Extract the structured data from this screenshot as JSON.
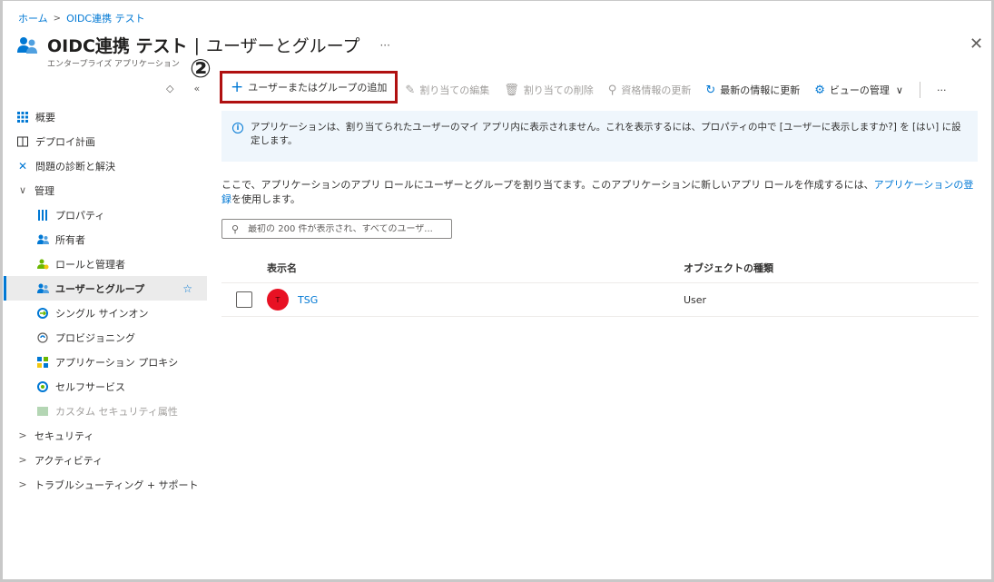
{
  "breadcrumb": {
    "home": "ホーム",
    "current": "OIDC連携 テスト"
  },
  "header": {
    "title": "OIDC連携 テスト",
    "page": "ユーザーとグループ",
    "separator": "|",
    "subtitle": "エンタープライズ アプリケーション",
    "more": "···",
    "close": "✕"
  },
  "annotation": "②",
  "sidebar": {
    "items": [
      {
        "label": "概要",
        "icon": "grid-icon",
        "level": 0
      },
      {
        "label": "デプロイ計画",
        "icon": "book-icon",
        "level": 0
      },
      {
        "label": "問題の診断と解決",
        "icon": "wrench-icon",
        "level": 0
      },
      {
        "label": "管理",
        "icon": "chevron-down-icon",
        "level": 0
      },
      {
        "label": "プロパティ",
        "icon": "properties-icon",
        "level": 1
      },
      {
        "label": "所有者",
        "icon": "owners-icon",
        "level": 1
      },
      {
        "label": "ロールと管理者",
        "icon": "roles-icon",
        "level": 1
      },
      {
        "label": "ユーザーとグループ",
        "icon": "users-icon",
        "level": 1,
        "selected": true
      },
      {
        "label": "シングル サインオン",
        "icon": "sso-icon",
        "level": 1
      },
      {
        "label": "プロビジョニング",
        "icon": "provisioning-icon",
        "level": 1
      },
      {
        "label": "アプリケーション プロキシ",
        "icon": "proxy-icon",
        "level": 1
      },
      {
        "label": "セルフサービス",
        "icon": "selfservice-icon",
        "level": 1
      },
      {
        "label": "カスタム セキュリティ属性",
        "icon": "custom-attr-icon",
        "level": 1,
        "disabled": true
      },
      {
        "label": "セキュリティ",
        "icon": "chevron-right-icon",
        "level": 0
      },
      {
        "label": "アクティビティ",
        "icon": "chevron-right-icon",
        "level": 0
      },
      {
        "label": "トラブルシューティング + サポート",
        "icon": "chevron-right-icon",
        "level": 0
      }
    ]
  },
  "toolbar": {
    "add": "ユーザーまたはグループの追加",
    "edit": "割り当ての編集",
    "remove": "割り当ての削除",
    "credentials": "資格情報の更新",
    "refresh": "最新の情報に更新",
    "manage_view": "ビューの管理",
    "more": "···"
  },
  "info": {
    "text": "アプリケーションは、割り当てられたユーザーのマイ アプリ内に表示されません。これを表示するには、プロパティの中で [ユーザーに表示しますか?] を [はい] に設定します。"
  },
  "description": {
    "text": "ここで、アプリケーションのアプリ ロールにユーザーとグループを割り当てます。このアプリケーションに新しいアプリ ロールを作成するには、",
    "link": "アプリケーションの登録",
    "suffix": "を使用します。"
  },
  "search": {
    "placeholder": "最初の 200 件が表示され、すべてのユーザ..."
  },
  "table": {
    "headers": {
      "name": "表示名",
      "type": "オブジェクトの種類"
    },
    "rows": [
      {
        "initial": "T",
        "name": "TSG",
        "type": "User"
      }
    ]
  },
  "colors": {
    "accent": "#0078d4",
    "highlight_border": "#b01010",
    "avatar": "#e81123"
  }
}
